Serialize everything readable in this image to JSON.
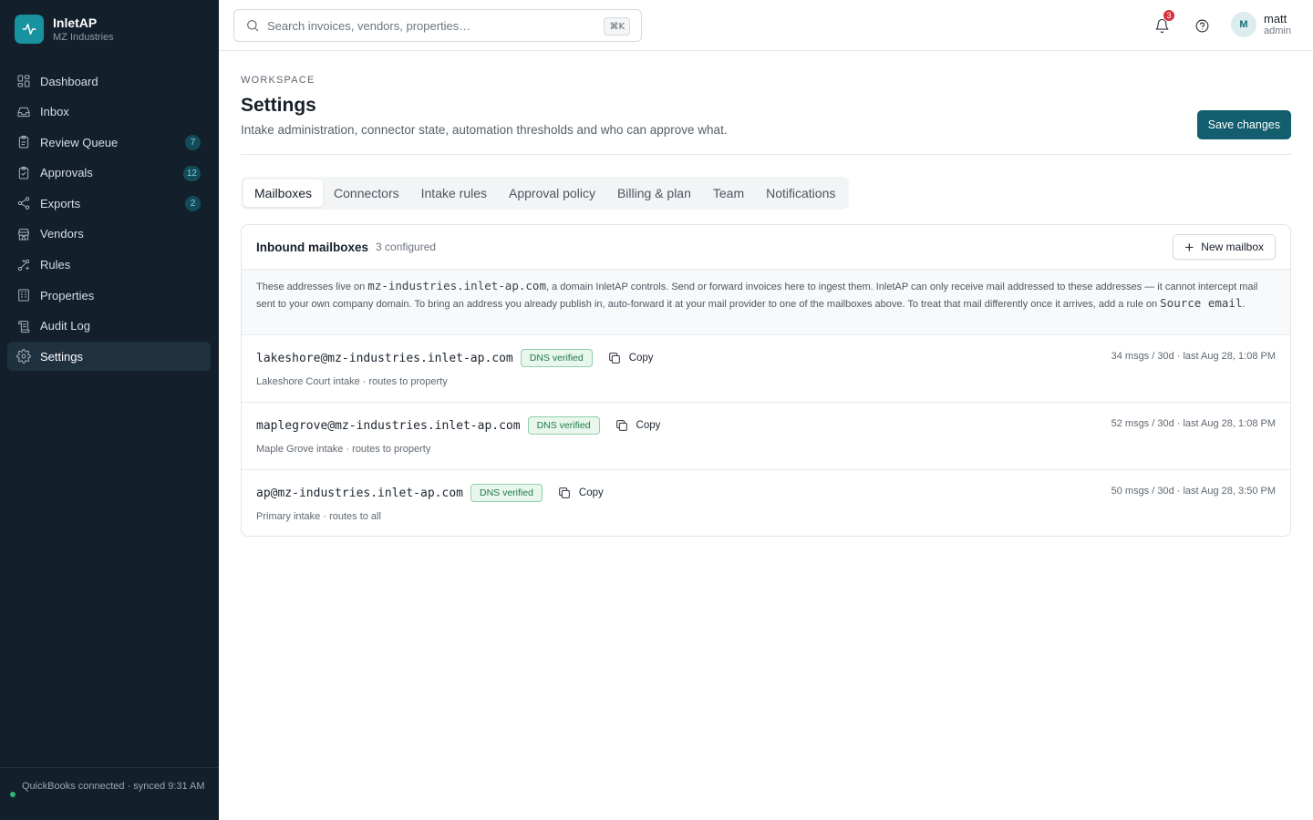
{
  "brand": {
    "name": "InletAP",
    "org": "MZ Industries",
    "logo_icon": "pulse-icon",
    "accent": "#17929e"
  },
  "sidebar": {
    "items": [
      {
        "label": "Dashboard",
        "icon": "dashboard-icon",
        "badge": ""
      },
      {
        "label": "Inbox",
        "icon": "inbox-icon",
        "badge": ""
      },
      {
        "label": "Review Queue",
        "icon": "clipboard-icon",
        "badge": "7"
      },
      {
        "label": "Approvals",
        "icon": "clipboard-check-icon",
        "badge": "12"
      },
      {
        "label": "Exports",
        "icon": "share-icon",
        "badge": "2"
      },
      {
        "label": "Vendors",
        "icon": "store-icon",
        "badge": ""
      },
      {
        "label": "Rules",
        "icon": "workflow-icon",
        "badge": ""
      },
      {
        "label": "Properties",
        "icon": "building-icon",
        "badge": ""
      },
      {
        "label": "Audit Log",
        "icon": "scroll-icon",
        "badge": ""
      },
      {
        "label": "Settings",
        "icon": "gear-icon",
        "badge": ""
      }
    ],
    "active": "Settings",
    "footer": "QuickBooks connected · synced 9:31 AM"
  },
  "topbar": {
    "search_placeholder": "Search invoices, vendors, properties…",
    "search_shortcut": "⌘K",
    "notification_count": "3",
    "user": {
      "initial": "M",
      "name": "matt",
      "role": "admin"
    }
  },
  "page": {
    "eyebrow": "WORKSPACE",
    "title": "Settings",
    "subtitle": "Intake administration, connector state, automation thresholds and who can approve what.",
    "save_label": "Save changes"
  },
  "tabs": [
    "Mailboxes",
    "Connectors",
    "Intake rules",
    "Approval policy",
    "Billing & plan",
    "Team",
    "Notifications"
  ],
  "active_tab": "Mailboxes",
  "mailboxes": {
    "title": "Inbound mailboxes",
    "count": "3 configured",
    "new_label": "New mailbox",
    "info": {
      "p1": "These addresses live on ",
      "domain": "mz-industries.inlet-ap.com",
      "p2": ", a domain InletAP controls. Send or forward invoices here to ingest them. InletAP can only receive mail addressed to these addresses — it cannot intercept mail sent to your own company domain. To bring an address you already publish in, auto-forward it at your mail provider to one of the mailboxes above. To treat that mail differently once it arrives, add a rule on ",
      "rule_field": "Source email",
      "p3": "."
    },
    "copy_label": "Copy",
    "rows": [
      {
        "address": "lakeshore@mz-industries.inlet-ap.com",
        "status": "DNS verified",
        "description": "Lakeshore Court intake · routes to property",
        "meta": "34 msgs / 30d · last Aug 28, 1:08 PM"
      },
      {
        "address": "maplegrove@mz-industries.inlet-ap.com",
        "status": "DNS verified",
        "description": "Maple Grove intake · routes to property",
        "meta": "52 msgs / 30d · last Aug 28, 1:08 PM"
      },
      {
        "address": "ap@mz-industries.inlet-ap.com",
        "status": "DNS verified",
        "description": "Primary intake · routes to all",
        "meta": "50 msgs / 30d · last Aug 28, 3:50 PM"
      }
    ]
  },
  "colors": {
    "sidebar_bg": "#13202c",
    "primary_button": "#135e6e",
    "verified_green": "#1f7a48",
    "notification_red": "#d9303e"
  }
}
